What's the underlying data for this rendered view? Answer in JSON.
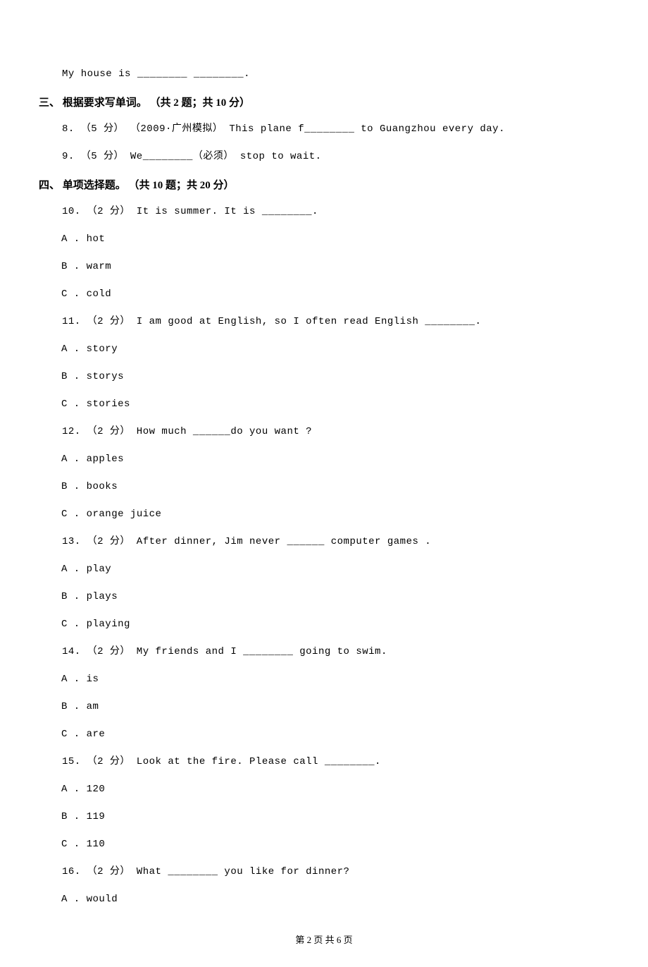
{
  "fragment": "My house is ________ ________.",
  "section3": {
    "heading": "三、 根据要求写单词。 （共 2 题；共 10 分）",
    "q8": "8. （5 分） （2009·广州模拟） This plane f________ to Guangzhou every day.",
    "q9": "9. （5 分） We________（必须） stop to wait."
  },
  "section4": {
    "heading": "四、 单项选择题。 （共 10 题；共 20 分）",
    "q10": {
      "text": "10. （2 分） It is summer. It is ________.",
      "a": "A . hot",
      "b": "B . warm",
      "c": "C . cold"
    },
    "q11": {
      "text": "11. （2 分） I am good at English, so I often read English ________.",
      "a": "A . story",
      "b": "B . storys",
      "c": "C . stories"
    },
    "q12": {
      "text": "12. （2 分） How much ______do you want ?",
      "a": "A . apples",
      "b": "B . books",
      "c": "C . orange juice"
    },
    "q13": {
      "text": "13. （2 分） After dinner, Jim never ______ computer games .",
      "a": "A . play",
      "b": "B . plays",
      "c": "C . playing"
    },
    "q14": {
      "text": "14. （2 分） My friends and I ________ going to swim.",
      "a": "A . is",
      "b": "B . am",
      "c": "C . are"
    },
    "q15": {
      "text": "15. （2 分） Look at the fire. Please call ________.",
      "a": "A . 120",
      "b": "B . 119",
      "c": "C . 110"
    },
    "q16": {
      "text": "16. （2 分） What ________ you like for dinner?",
      "a": "A . would"
    }
  },
  "footer": "第 2 页 共 6 页"
}
